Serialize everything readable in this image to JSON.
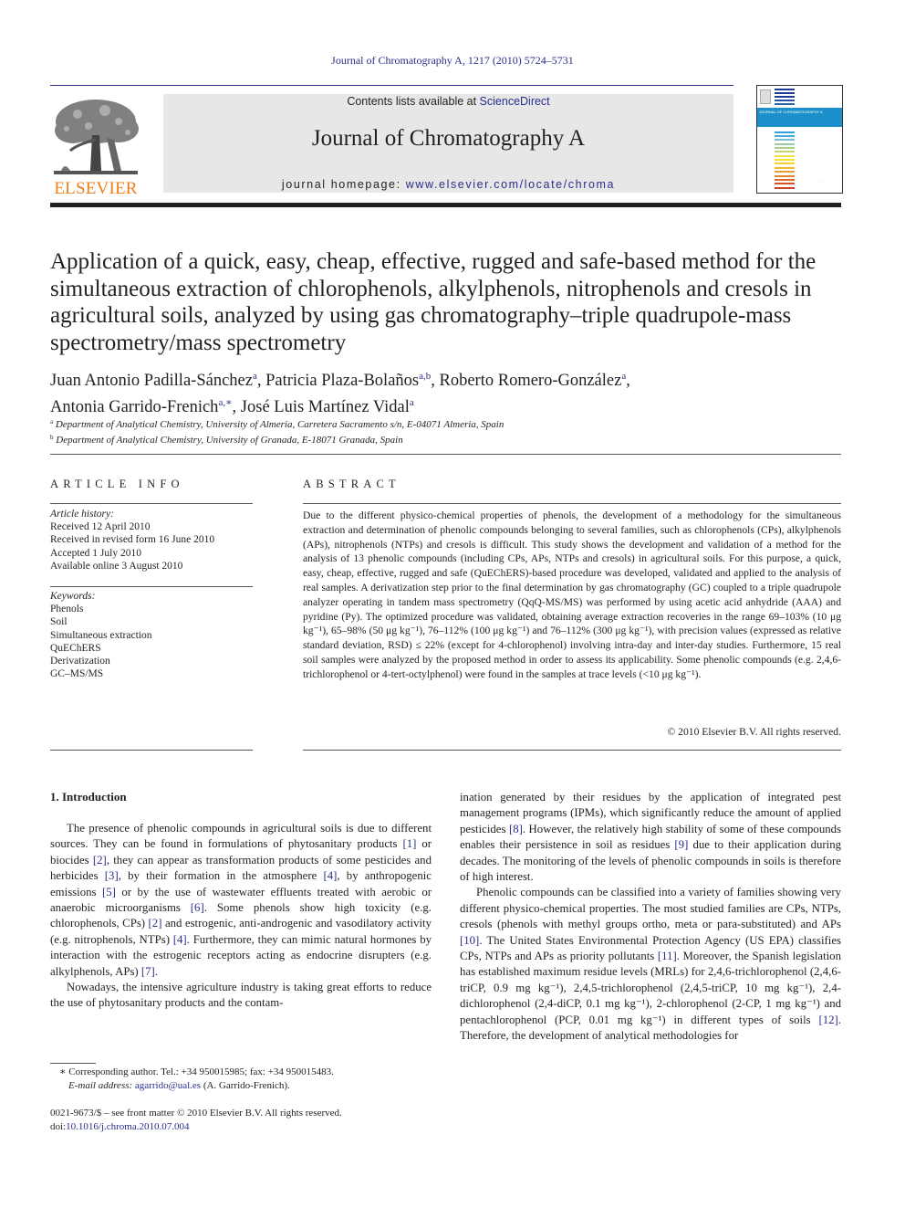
{
  "header": {
    "journal_reference": "Journal of Chromatography A, 1217 (2010) 5724–5731",
    "contents_prefix": "Contents lists available at ",
    "contents_link": "ScienceDirect",
    "journal_title": "Journal of Chromatography A",
    "homepage_prefix": "journal homepage: ",
    "homepage_link": "www.elsevier.com/locate/chroma",
    "publisher_logo_text": "ELSEVIER",
    "cover_band_text": "JOURNAL OF CHROMATOGRAPHY A",
    "colors": {
      "link": "#2a2e8a",
      "elsevier_orange": "#f07f1a",
      "masthead_bg": "#e7e7e7",
      "cover_band": "#1d8fcb"
    }
  },
  "article": {
    "title": "Application of a quick, easy, cheap, effective, rugged and safe-based method for the simultaneous extraction of chlorophenols, alkylphenols, nitrophenols and cresols in agricultural soils, analyzed by using gas chromatography–triple quadrupole-mass spectrometry/mass spectrometry",
    "authors": [
      {
        "name": "Juan Antonio Padilla-Sánchez",
        "affil": "a",
        "sep": ", "
      },
      {
        "name": "Patricia Plaza-Bolaños",
        "affil": "a,b",
        "sep": ", "
      },
      {
        "name": "Roberto Romero-González",
        "affil": "a",
        "sep": ","
      },
      {
        "name": "Antonia Garrido-Frenich",
        "affil": "a,∗",
        "sep": ", "
      },
      {
        "name": "José Luis Martínez Vidal",
        "affil": "a",
        "sep": ""
      }
    ],
    "affiliations": [
      {
        "key": "a",
        "text": "Department of Analytical Chemistry, University of Almeria, Carretera Sacramento s/n, E-04071 Almeria, Spain"
      },
      {
        "key": "b",
        "text": "Department of Analytical Chemistry, University of Granada, E-18071 Granada, Spain"
      }
    ]
  },
  "article_info": {
    "heading": "ARTICLE INFO",
    "history_label": "Article history:",
    "history": [
      "Received 12 April 2010",
      "Received in revised form 16 June 2010",
      "Accepted 1 July 2010",
      "Available online 3 August 2010"
    ],
    "keywords_label": "Keywords:",
    "keywords": [
      "Phenols",
      "Soil",
      "Simultaneous extraction",
      "QuEChERS",
      "Derivatization",
      "GC–MS/MS"
    ]
  },
  "abstract": {
    "heading": "ABSTRACT",
    "text": "Due to the different physico-chemical properties of phenols, the development of a methodology for the simultaneous extraction and determination of phenolic compounds belonging to several families, such as chlorophenols (CPs), alkylphenols (APs), nitrophenols (NTPs) and cresols is difficult. This study shows the development and validation of a method for the analysis of 13 phenolic compounds (including CPs, APs, NTPs and cresols) in agricultural soils. For this purpose, a quick, easy, cheap, effective, rugged and safe (QuEChERS)-based procedure was developed, validated and applied to the analysis of real samples. A derivatization step prior to the final determination by gas chromatography (GC) coupled to a triple quadrupole analyzer operating in tandem mass spectrometry (QqQ-MS/MS) was performed by using acetic acid anhydride (AAA) and pyridine (Py). The optimized procedure was validated, obtaining average extraction recoveries in the range 69–103% (10 μg kg⁻¹), 65–98% (50 μg kg⁻¹), 76–112% (100 μg kg⁻¹) and 76–112% (300 μg kg⁻¹), with precision values (expressed as relative standard deviation, RSD) ≤ 22% (except for 4-chlorophenol) involving intra-day and inter-day studies. Furthermore, 15 real soil samples were analyzed by the proposed method in order to assess its applicability. Some phenolic compounds (e.g. 2,4,6-trichlorophenol or 4-tert-octylphenol) were found in the samples at trace levels (<10 μg kg⁻¹).",
    "copyright": "© 2010 Elsevier B.V. All rights reserved."
  },
  "body": {
    "section_heading": "1.  Introduction",
    "left_paragraphs": [
      [
        {
          "t": "The presence of phenolic compounds in agricultural soils is due to different sources. They can be found in formulations of phytosanitary products "
        },
        {
          "ref": "[1]"
        },
        {
          "t": " or biocides "
        },
        {
          "ref": "[2]"
        },
        {
          "t": ", they can appear as transformation products of some pesticides and herbicides "
        },
        {
          "ref": "[3]"
        },
        {
          "t": ", by their formation in the atmosphere "
        },
        {
          "ref": "[4]"
        },
        {
          "t": ", by anthropogenic emissions "
        },
        {
          "ref": "[5]"
        },
        {
          "t": " or by the use of wastewater effluents treated with aerobic or anaerobic microorganisms "
        },
        {
          "ref": "[6]"
        },
        {
          "t": ". Some phenols show high toxicity (e.g. chlorophenols, CPs) "
        },
        {
          "ref": "[2]"
        },
        {
          "t": " and estrogenic, anti-androgenic and vasodilatory activity (e.g. nitrophenols, NTPs) "
        },
        {
          "ref": "[4]"
        },
        {
          "t": ". Furthermore, they can mimic natural hormones by interaction with the estrogenic receptors acting as endocrine disrupters (e.g. alkylphenols, APs) "
        },
        {
          "ref": "[7]"
        },
        {
          "t": "."
        }
      ],
      [
        {
          "t": "Nowadays, the intensive agriculture industry is taking great efforts to reduce the use of phytosanitary products and the contam-"
        }
      ]
    ],
    "right_paragraphs": [
      [
        {
          "t": "ination generated by their residues by the application of integrated pest management programs (IPMs), which significantly reduce the amount of applied pesticides "
        },
        {
          "ref": "[8]"
        },
        {
          "t": ". However, the relatively high stability of some of these compounds enables their persistence in soil as residues "
        },
        {
          "ref": "[9]"
        },
        {
          "t": " due to their application during decades. The monitoring of the levels of phenolic compounds in soils is therefore of high interest."
        }
      ],
      [
        {
          "t": "Phenolic compounds can be classified into a variety of families showing very different physico-chemical properties. The most studied families are CPs, NTPs, cresols (phenols with methyl groups ortho, meta or para-substituted) and APs "
        },
        {
          "ref": "[10]"
        },
        {
          "t": ". The United States Environmental Protection Agency (US EPA) classifies CPs, NTPs and APs as priority pollutants "
        },
        {
          "ref": "[11]"
        },
        {
          "t": ". Moreover, the Spanish legislation has established maximum residue levels (MRLs) for 2,4,6-trichlorophenol (2,4,6-triCP, 0.9 mg kg⁻¹), 2,4,5-trichlorophenol (2,4,5-triCP, 10 mg kg⁻¹), 2,4-dichlorophenol (2,4-diCP, 0.1 mg kg⁻¹), 2-chlorophenol (2-CP, 1 mg kg⁻¹) and pentachlorophenol (PCP, 0.01 mg kg⁻¹) in different types of soils "
        },
        {
          "ref": "[12]"
        },
        {
          "t": ". Therefore, the development of analytical methodologies for"
        }
      ]
    ]
  },
  "footnotes": {
    "corresponding": "∗  Corresponding author. Tel.: +34 950015985; fax: +34 950015483.",
    "email_label": "E-mail address: ",
    "email": "agarrido@ual.es",
    "email_suffix": " (A. Garrido-Frenich).",
    "front_matter": "0021-9673/$ – see front matter © 2010 Elsevier B.V. All rights reserved.",
    "doi_label": "doi:",
    "doi": "10.1016/j.chroma.2010.07.004"
  }
}
